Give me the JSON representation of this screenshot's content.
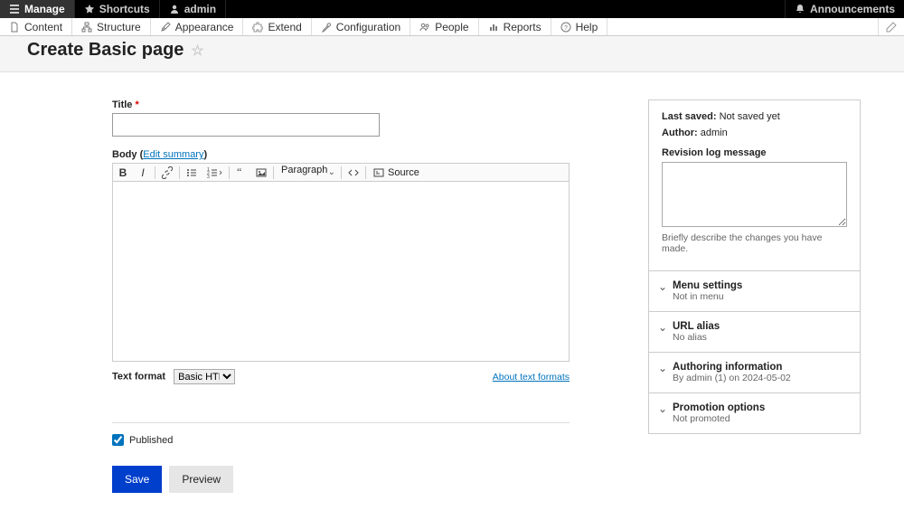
{
  "toolbar": {
    "manage": "Manage",
    "shortcuts": "Shortcuts",
    "user": "admin",
    "announcements": "Announcements"
  },
  "admin_menu": {
    "content": "Content",
    "structure": "Structure",
    "appearance": "Appearance",
    "extend": "Extend",
    "configuration": "Configuration",
    "people": "People",
    "reports": "Reports",
    "help": "Help"
  },
  "page": {
    "title": "Create Basic page"
  },
  "form": {
    "title_label": "Title",
    "body_label": "Body",
    "edit_summary": "Edit summary",
    "heading_select": "Paragraph",
    "source_label": "Source",
    "text_format_label": "Text format",
    "text_format_value": "Basic HTML",
    "about_formats": "About text formats",
    "published": "Published",
    "save": "Save",
    "preview": "Preview"
  },
  "sidebar": {
    "last_saved_label": "Last saved:",
    "last_saved_value": "Not saved yet",
    "author_label": "Author:",
    "author_value": "admin",
    "revision_label": "Revision log message",
    "revision_help": "Briefly describe the changes you have made.",
    "menu_settings": {
      "title": "Menu settings",
      "sub": "Not in menu"
    },
    "url_alias": {
      "title": "URL alias",
      "sub": "No alias"
    },
    "authoring": {
      "title": "Authoring information",
      "sub": "By admin (1) on 2024-05-02"
    },
    "promotion": {
      "title": "Promotion options",
      "sub": "Not promoted"
    }
  }
}
